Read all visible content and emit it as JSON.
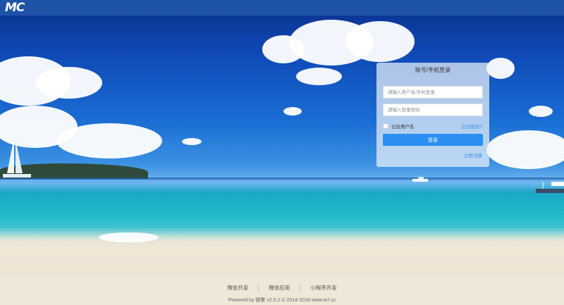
{
  "header": {
    "logo_text": "MC"
  },
  "login": {
    "title": "账号/手机登录",
    "username_placeholder": "请输入用户名/手机登录",
    "password_placeholder": "请输入登录密码",
    "remember_label": "记住用户名",
    "forgot_label": "忘记密码?",
    "submit_label": "登录",
    "register_label": "立即注册",
    "accent_color": "#2a8ff0"
  },
  "footer": {
    "links": [
      "微信开发",
      "微信应用",
      "小程序开发"
    ],
    "copyright": "Powered by 微擎 v2.5.2 © 2014-2018 www.w7.cc"
  }
}
